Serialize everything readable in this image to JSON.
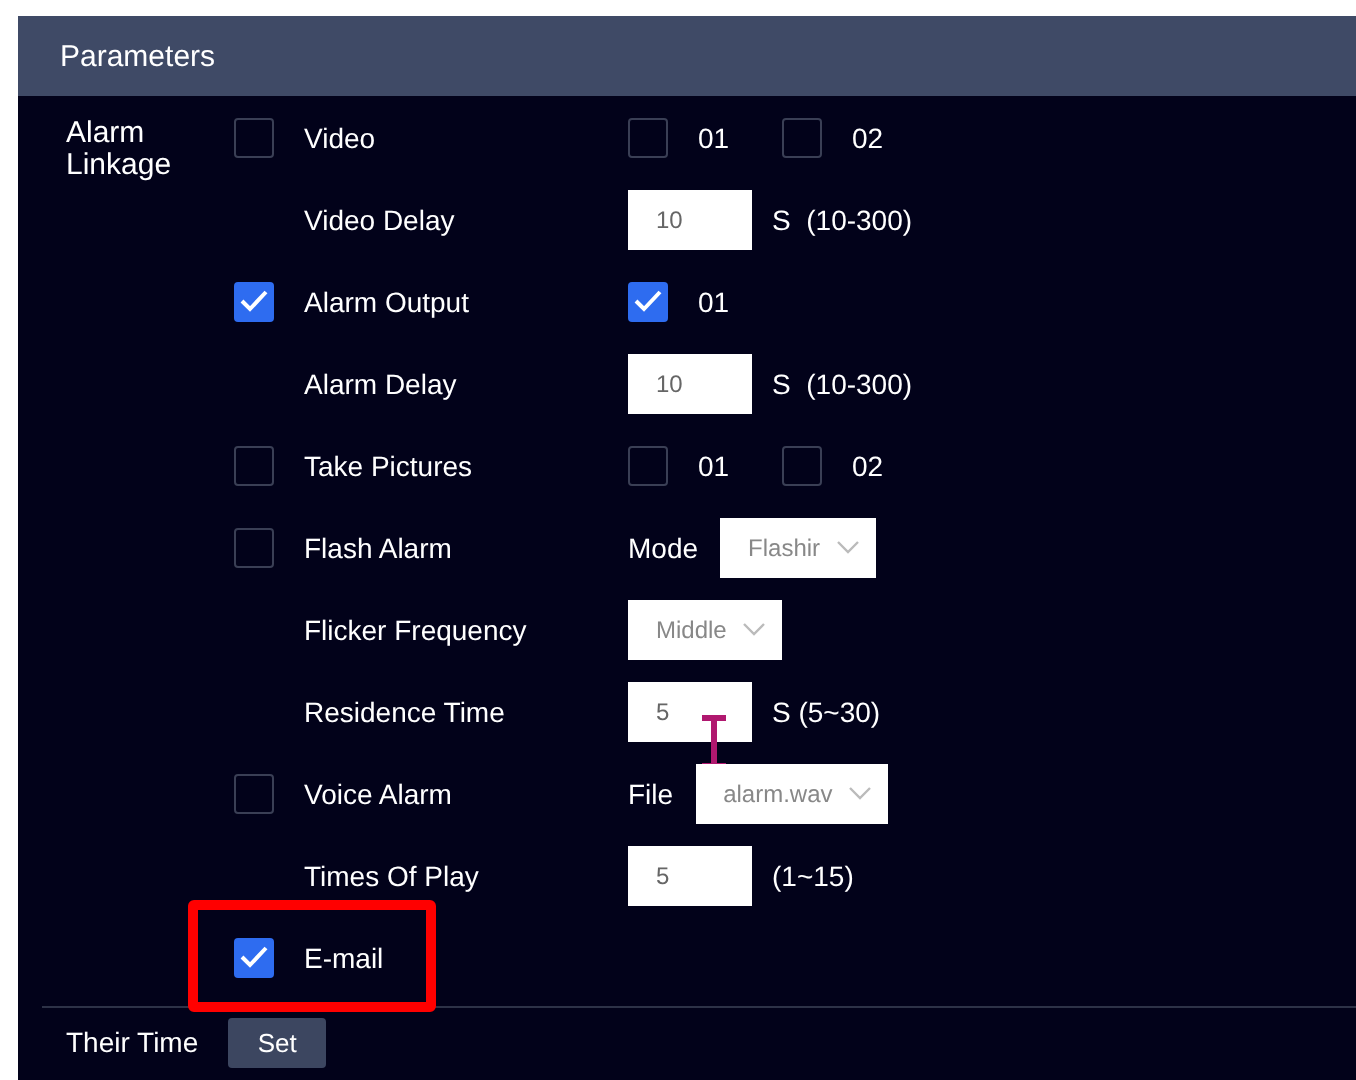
{
  "panel": {
    "title": "Parameters"
  },
  "section": {
    "label": "Alarm Linkage"
  },
  "rows": [
    {
      "kind": "toggle",
      "checked": false,
      "label": "Video",
      "controls": [
        {
          "kind": "check",
          "checked": false,
          "label": "01"
        },
        {
          "kind": "check",
          "checked": false,
          "label": "02"
        }
      ]
    },
    {
      "kind": "plain",
      "label": "Video Delay",
      "controls": [
        {
          "kind": "input",
          "value": "10"
        },
        {
          "kind": "text",
          "text": "S  (10-300)"
        }
      ]
    },
    {
      "kind": "toggle",
      "checked": true,
      "label": "Alarm Output",
      "controls": [
        {
          "kind": "check",
          "checked": true,
          "label": "01"
        }
      ]
    },
    {
      "kind": "plain",
      "label": "Alarm Delay",
      "controls": [
        {
          "kind": "input",
          "value": "10"
        },
        {
          "kind": "text",
          "text": "S  (10-300)"
        }
      ]
    },
    {
      "kind": "toggle",
      "checked": false,
      "label": "Take Pictures",
      "controls": [
        {
          "kind": "check",
          "checked": false,
          "label": "01"
        },
        {
          "kind": "check",
          "checked": false,
          "label": "02"
        }
      ]
    },
    {
      "kind": "toggle",
      "checked": false,
      "label": "Flash Alarm",
      "controls": [
        {
          "kind": "label",
          "text": "Mode"
        },
        {
          "kind": "select",
          "value": "Flashir"
        }
      ]
    },
    {
      "kind": "plain",
      "label": "Flicker Frequency",
      "controls": [
        {
          "kind": "select",
          "value": "Middle"
        }
      ]
    },
    {
      "kind": "plain",
      "label": "Residence Time",
      "cursor": true,
      "controls": [
        {
          "kind": "input",
          "value": "5"
        },
        {
          "kind": "text",
          "text": "S (5~30)"
        }
      ]
    },
    {
      "kind": "toggle",
      "checked": false,
      "label": "Voice Alarm",
      "controls": [
        {
          "kind": "label",
          "text": "File"
        },
        {
          "kind": "select",
          "value": "alarm.wav"
        }
      ]
    },
    {
      "kind": "plain",
      "label": "Times Of Play",
      "controls": [
        {
          "kind": "input",
          "value": "5"
        },
        {
          "kind": "text",
          "text": "(1~15)"
        }
      ]
    },
    {
      "kind": "toggle",
      "checked": true,
      "label": "E-mail",
      "highlighted": true,
      "controls": []
    }
  ],
  "footer": {
    "label": "Their Time",
    "button": "Set"
  }
}
